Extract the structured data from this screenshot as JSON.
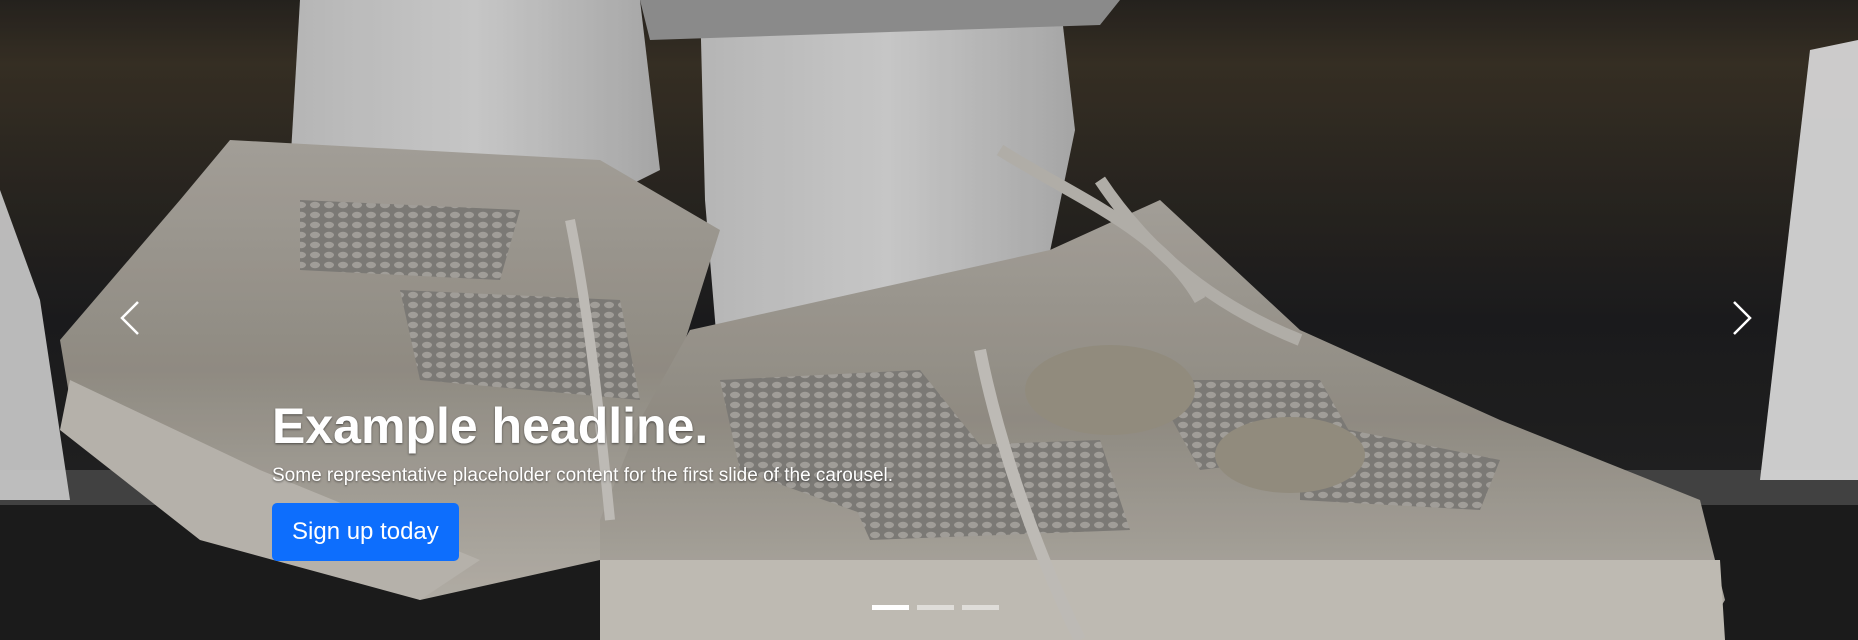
{
  "carousel": {
    "caption": {
      "headline": "Example headline.",
      "text": "Some representative placeholder content for the first slide of the carousel.",
      "button_label": "Sign up today"
    },
    "indicators": [
      {
        "active": true
      },
      {
        "active": false
      },
      {
        "active": false
      }
    ],
    "slide_image": "sneakers-photo",
    "icons": {
      "prev": "chevron-left-icon",
      "next": "chevron-right-icon"
    },
    "colors": {
      "button": "#0d6efd",
      "caption_text": "#ffffff"
    }
  }
}
